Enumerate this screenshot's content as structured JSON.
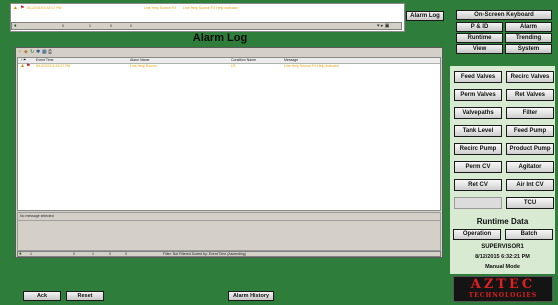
{
  "top_strip": {
    "alarm_time": "8/12/2015 6:32:07 PM",
    "alarm_source": "Line Help Source FX",
    "alarm_message": "Line Help Source FX Help Indicator",
    "counts": [
      "0",
      "1",
      "0",
      "0"
    ]
  },
  "buttons": {
    "alarm_log_top": "Alarm Log",
    "on_screen_keyboard": "On-Screen Keyboard",
    "pid": "P & ID",
    "alarm": "Alarm",
    "runtime": "Runtime",
    "trending": "Trending",
    "view": "View",
    "system": "System",
    "ack": "Ack",
    "reset": "Reset",
    "alarm_history": "Alarm History"
  },
  "alarm_log": {
    "title": "Alarm Log",
    "columns": [
      "Event Time",
      "Alarm Name",
      "Condition Name",
      "Message"
    ],
    "row": {
      "time": "8/12/2015 6:32:07 PM",
      "name": "Line Help Source",
      "condition": "LR",
      "message": "Line Help Source FX Help Indicator"
    },
    "no_message": "No message selected",
    "status_counts": [
      "1",
      "0",
      "1",
      "0",
      "0"
    ],
    "filter_text": "Filter: Not Filtered   Sorted by: Event Time (Ascending)"
  },
  "nav": [
    [
      "Feed Valves",
      "Recirc Valves"
    ],
    [
      "Perm Valves",
      "Ret Valves"
    ],
    [
      "Valvepaths",
      "Filter"
    ],
    [
      "Tank Level",
      "Feed Pump"
    ],
    [
      "Recirc Pump",
      "Product Pump"
    ],
    [
      "Perm CV",
      "Agitator"
    ],
    [
      "Ret CV",
      "Air Int CV"
    ],
    [
      "",
      "TCU"
    ]
  ],
  "runtime_data": {
    "title": "Runtime Data",
    "operation": "Operation",
    "batch": "Batch",
    "user": "SUPERVISOR1",
    "datetime": "8/12/2015 6:32:21 PM",
    "mode": "Manual Mode"
  },
  "logo": {
    "line1": "AZTEC",
    "line2": "TECHNOLOGIES",
    "color": "#e02020"
  }
}
